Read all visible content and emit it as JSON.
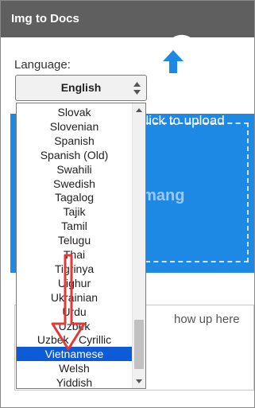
{
  "app": {
    "title": "Img to Docs"
  },
  "language": {
    "label": "Language:",
    "selected": "English",
    "options": [
      "Slovak",
      "Slovenian",
      "Spanish",
      "Spanish (Old)",
      "Swahili",
      "Swedish",
      "Tagalog",
      "Tajik",
      "Tamil",
      "Telugu",
      "Thai",
      "Tigrinya",
      "Uighur",
      "Ukrainian",
      "Urdu",
      "Uzbek",
      "Uzbek - Cyrillic",
      "Vietnamese",
      "Welsh",
      "Yiddish"
    ],
    "highlighted": "Vietnamese"
  },
  "upload": {
    "text": "click to upload"
  },
  "output": {
    "placeholder": "how up here"
  },
  "watermark": {
    "text": "Quantrimang"
  },
  "colors": {
    "titlebar": "#5f5f5f",
    "dropzone": "#1e88e5",
    "highlight": "#0d5bd6",
    "annotation_arrow": "#e53935"
  }
}
